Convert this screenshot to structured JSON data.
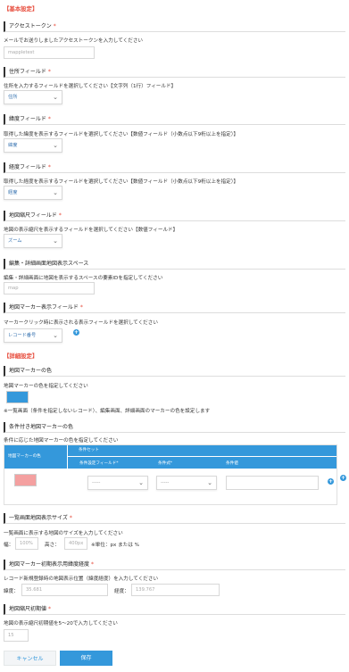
{
  "basic_title": "【基本設定】",
  "access_token": {
    "label": "アクセストークン",
    "desc": "メールでお送りしましたアクセストークンを入力してください",
    "value": "mappletest"
  },
  "address_field": {
    "label": "住所フィールド",
    "desc": "住所を入力するフィールドを選択してください【文字列（1行）フィールド】",
    "value": "住所"
  },
  "lat_field": {
    "label": "緯度フィールド",
    "desc": "取得した緯度を表示するフィールドを選択してください【数値フィールド（小数点以下9桁以上を指定）】",
    "value": "緯度"
  },
  "lng_field": {
    "label": "経度フィールド",
    "desc": "取得した経度を表示するフィールドを選択してください【数値フィールド（小数点以下9桁以上を指定）】",
    "value": "経度"
  },
  "zoom_field": {
    "label": "地図縮尺フィールド",
    "desc": "地図の表示縮尺を表示するフィールドを選択してください【数値フィールド】",
    "value": "ズーム"
  },
  "edit_space": {
    "label": "編集・詳細画面地図表示スペース",
    "desc": "編集・詳細画面に地図を表示するスペースの要素IDを指定してください",
    "value": "map"
  },
  "marker_field": {
    "label": "地図マーカー表示フィールド",
    "desc": "マーカークリック時に表示される表示フィールドを選択してください",
    "value": "レコード番号"
  },
  "detail_title": "【詳細設定】",
  "marker_color": {
    "label": "地図マーカーの色",
    "desc": "地図マーカーの色を指定してください",
    "note": "※一覧画面（条件を指定しないレコード）、編集画面、詳細画面のマーカーの色を設定します",
    "color": "#3498db"
  },
  "cond_color": {
    "label": "条件付き地図マーカーの色",
    "desc": "条件に応じた地図マーカーの色を指定してください",
    "col_color": "地図マーカーの色",
    "col_set": "条件セット",
    "col_field": "条件設定フィールド",
    "col_op": "条件式",
    "col_value": "条件値",
    "row_color": "#f4a0a0",
    "row_field": "-----",
    "row_op": "-----"
  },
  "list_size": {
    "label": "一覧画面地図表示サイズ",
    "desc": "一覧画面に表示する地図のサイズを入力してください",
    "width_label": "幅：",
    "width_value": "100%",
    "height_label": "高さ：",
    "height_value": "400px",
    "unit_note": "※単位：px または %"
  },
  "init_pos": {
    "label": "地図マーカー初期表示用緯度経度",
    "desc": "レコード新規登録時の地図表示位置（緯度経度）を入力してください",
    "lat_label": "緯度：",
    "lat_value": "35.681",
    "lng_label": "経度：",
    "lng_value": "139.767"
  },
  "init_zoom": {
    "label": "地図縮尺初期値",
    "desc": "地図の表示縮尺初期値を5〜20で入力してください",
    "value": "15"
  },
  "buttons": {
    "cancel": "キャンセル",
    "save": "保存"
  },
  "required_mark": "*"
}
